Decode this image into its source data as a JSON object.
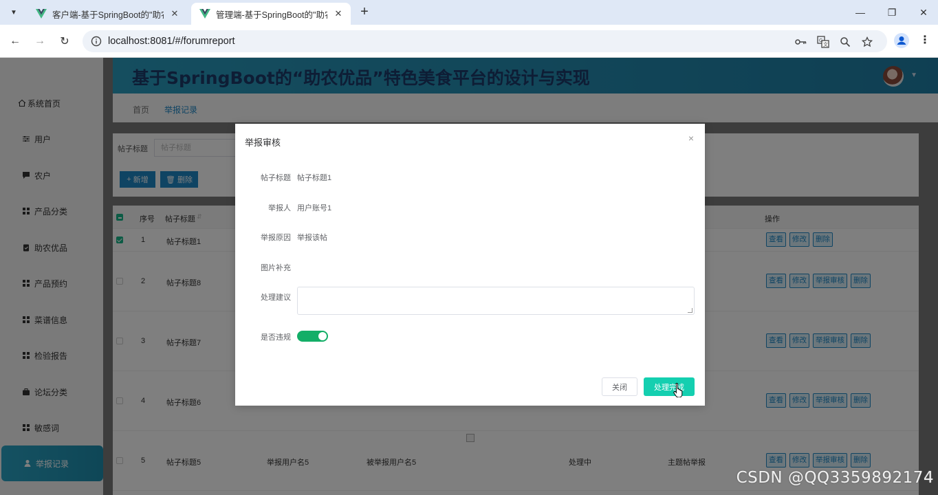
{
  "browser": {
    "tabs": [
      {
        "title": "客户端-基于SpringBoot的\"助农",
        "active": false
      },
      {
        "title": "管理端-基于SpringBoot的\"助农",
        "active": true
      }
    ],
    "url": "localhost:8081/#/forumreport",
    "toolbar_icons": [
      "key-icon",
      "translate-icon",
      "zoom-icon",
      "star-icon"
    ]
  },
  "header": {
    "title": "基于SpringBoot的“助农优品”特色美食平台的设计与实现"
  },
  "sidebar": {
    "items": [
      {
        "label": "系统首页",
        "icon": "home-icon"
      },
      {
        "label": "用户",
        "icon": "sliders-icon"
      },
      {
        "label": "农户",
        "icon": "chat-icon"
      },
      {
        "label": "产品分类",
        "icon": "grid-icon"
      },
      {
        "label": "助农优品",
        "icon": "clipboard-icon"
      },
      {
        "label": "产品预约",
        "icon": "grid-icon"
      },
      {
        "label": "菜谱信息",
        "icon": "grid-icon"
      },
      {
        "label": "检验报告",
        "icon": "grid-icon"
      },
      {
        "label": "论坛分类",
        "icon": "briefcase-icon"
      },
      {
        "label": "敏感词",
        "icon": "grid-icon"
      },
      {
        "label": "举报记录",
        "icon": "user-icon",
        "active": true
      }
    ]
  },
  "breadcrumb": {
    "home": "首页",
    "current": "举报记录"
  },
  "search": {
    "label": "帖子标题",
    "placeholder": "帖子标题"
  },
  "actions": {
    "add": "新增",
    "delete": "删除"
  },
  "table": {
    "headers": {
      "index": "序号",
      "title": "帖子标题",
      "operations": "操作"
    },
    "rows": [
      {
        "index": "1",
        "title": "帖子标题1",
        "checked": true,
        "ops": [
          "查看",
          "修改",
          "删除"
        ]
      },
      {
        "index": "2",
        "title": "帖子标题8",
        "checked": false,
        "ops": [
          "查看",
          "修改",
          "举报审核",
          "删除"
        ]
      },
      {
        "index": "3",
        "title": "帖子标题7",
        "checked": false,
        "ops": [
          "查看",
          "修改",
          "举报审核",
          "删除"
        ]
      },
      {
        "index": "4",
        "title": "帖子标题6",
        "checked": false,
        "ops": [
          "查看",
          "修改",
          "举报审核",
          "删除"
        ]
      },
      {
        "index": "5",
        "title": "帖子标题5",
        "checked": false,
        "reporter": "举报用户名5",
        "reported": "被举报用户名5",
        "status": "处理中",
        "type": "主题帖举报",
        "ops": [
          "查看",
          "修改",
          "举报审核",
          "删除"
        ]
      }
    ]
  },
  "dialog": {
    "title": "举报审核",
    "fields": {
      "post_title_label": "帖子标题",
      "post_title_value": "帖子标题1",
      "reporter_label": "举报人",
      "reporter_value": "用户账号1",
      "reason_label": "举报原因",
      "reason_value": "举报该帖",
      "image_label": "图片补充",
      "suggestion_label": "处理建议",
      "suggestion_value": "",
      "violation_label": "是否违规",
      "violation_on": true
    },
    "buttons": {
      "close": "关闭",
      "done": "处理完成"
    }
  },
  "watermark": "CSDN @QQ3359892174"
}
